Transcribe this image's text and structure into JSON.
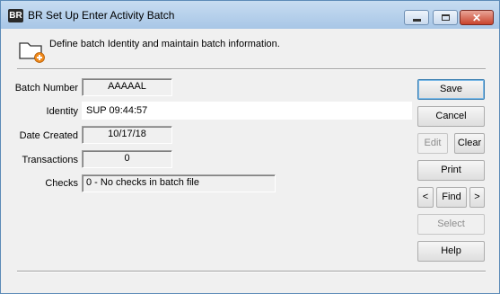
{
  "window": {
    "app_badge": "BR",
    "title": "BR Set Up Enter Activity Batch"
  },
  "header": {
    "description": "Define batch Identity and maintain batch information.",
    "icon": "folder-add-icon"
  },
  "form": {
    "batch_number": {
      "label": "Batch Number",
      "value": "AAAAAL"
    },
    "identity": {
      "label": "Identity",
      "value": "SUP 09:44:57"
    },
    "date_created": {
      "label": "Date Created",
      "value": "10/17/18"
    },
    "transactions": {
      "label": "Transactions",
      "value": "0"
    },
    "checks": {
      "label": "Checks",
      "value": "0 - No checks in batch file"
    }
  },
  "buttons": {
    "save": "Save",
    "cancel": "Cancel",
    "edit": "Edit",
    "clear": "Clear",
    "print": "Print",
    "prev": "<",
    "find": "Find",
    "next": ">",
    "select": "Select",
    "help": "Help"
  },
  "colors": {
    "titlebar": "#a8c6e6",
    "close_button": "#c9432c",
    "default_button_border": "#3c7fb1"
  }
}
